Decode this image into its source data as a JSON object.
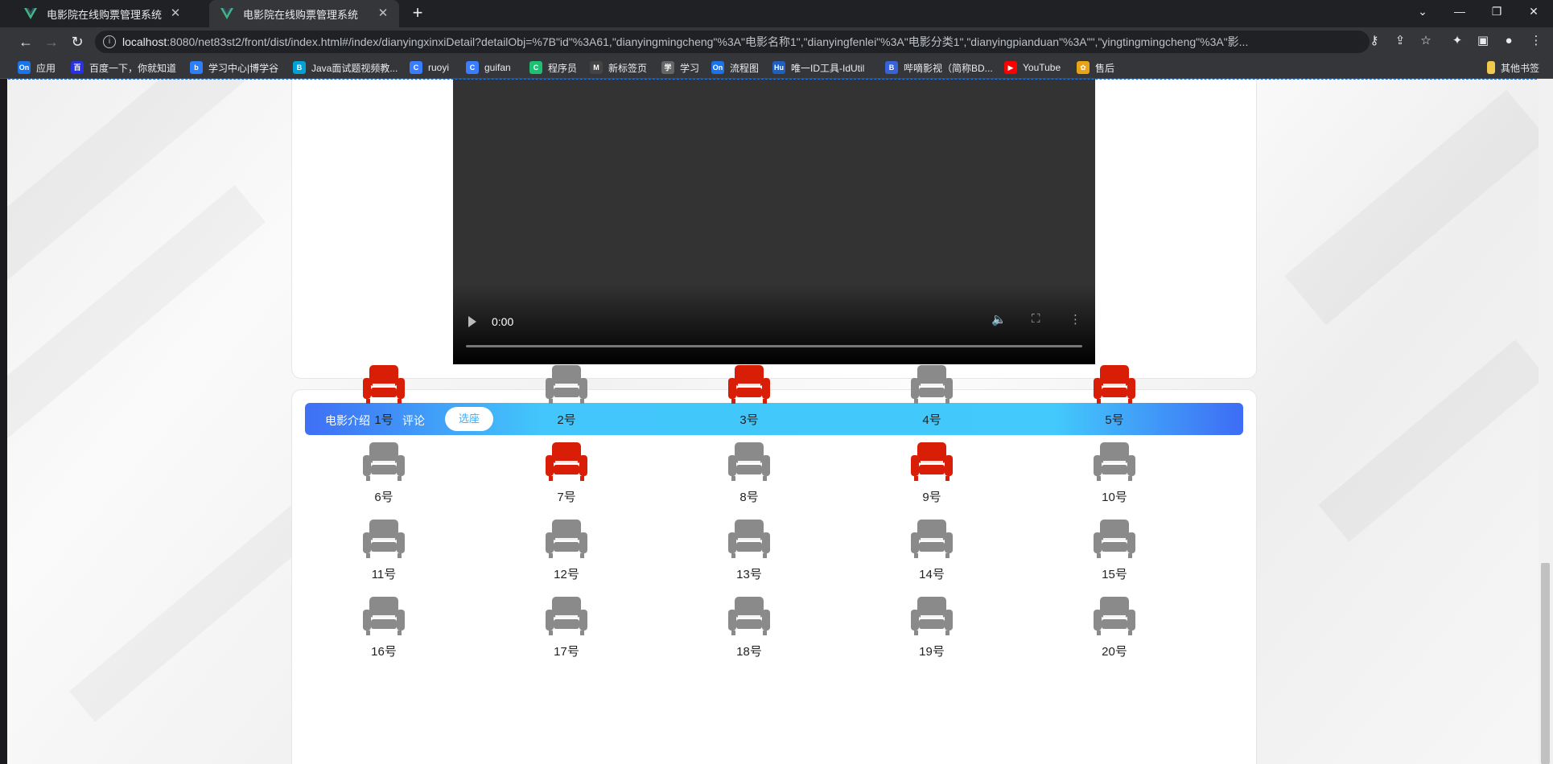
{
  "browser": {
    "tabs": [
      {
        "title": "电影院在线购票管理系统"
      },
      {
        "title": "电影院在线购票管理系统"
      }
    ],
    "url_host": "localhost",
    "url_rest": ":8080/net83st2/front/dist/index.html#/index/dianyingxinxiDetail?detailObj=%7B\"id\"%3A61,\"dianyingmingcheng\"%3A\"电影名称1\",\"dianyingfenlei\"%3A\"电影分类1\",\"dianyingpianduan\"%3A\"\",\"yingtingmingcheng\"%3A\"影...",
    "bookmarks": [
      {
        "label": "应用",
        "icon": "apps-icon",
        "color": "#1a73e8",
        "glyph": "On"
      },
      {
        "label": "百度一下，你就知道",
        "icon": "baidu-icon",
        "color": "#2932e1",
        "glyph": "百"
      },
      {
        "label": "学习中心|博学谷",
        "icon": "boxuegu-icon",
        "color": "#2d7ff9",
        "glyph": "b"
      },
      {
        "label": "Java面试题视频教...",
        "icon": "bilibili-icon",
        "color": "#00a1d6",
        "glyph": "B"
      },
      {
        "label": "ruoyi",
        "icon": "csdn-icon",
        "color": "#3a7cff",
        "glyph": "C"
      },
      {
        "label": "guifan",
        "icon": "csdn-icon",
        "color": "#3a7cff",
        "glyph": "C"
      },
      {
        "label": "程序员",
        "icon": "c-icon",
        "color": "#1dbf73",
        "glyph": "C"
      },
      {
        "label": "新标签页",
        "icon": "m-icon",
        "color": "#444444",
        "glyph": "M"
      },
      {
        "label": "学习",
        "icon": "notion-icon",
        "color": "#666666",
        "glyph": "学"
      },
      {
        "label": "流程图",
        "icon": "processon-icon",
        "color": "#1a73e8",
        "glyph": "On"
      },
      {
        "label": "唯一ID工具-IdUtil",
        "icon": "hutool-icon",
        "color": "#1e5fbf",
        "glyph": "Hu"
      },
      {
        "label": "哔嘀影视（简称BD...",
        "icon": "bd-icon",
        "color": "#3a62d8",
        "glyph": "B"
      },
      {
        "label": "YouTube",
        "icon": "youtube-icon",
        "color": "#ff0000",
        "glyph": "▶"
      },
      {
        "label": "售后",
        "icon": "shouhou-icon",
        "color": "#e8a317",
        "glyph": "✿"
      }
    ],
    "other_bookmarks": "其他书签"
  },
  "video": {
    "time": "0:00"
  },
  "detail_tabs": {
    "intro": "电影介绍",
    "comment": "评论",
    "seat": "选座"
  },
  "seats": [
    {
      "label": "1号",
      "taken": true
    },
    {
      "label": "2号",
      "taken": false
    },
    {
      "label": "3号",
      "taken": true
    },
    {
      "label": "4号",
      "taken": false
    },
    {
      "label": "5号",
      "taken": true
    },
    {
      "label": "6号",
      "taken": false
    },
    {
      "label": "7号",
      "taken": true
    },
    {
      "label": "8号",
      "taken": false
    },
    {
      "label": "9号",
      "taken": true
    },
    {
      "label": "10号",
      "taken": false
    },
    {
      "label": "11号",
      "taken": false
    },
    {
      "label": "12号",
      "taken": false
    },
    {
      "label": "13号",
      "taken": false
    },
    {
      "label": "14号",
      "taken": false
    },
    {
      "label": "15号",
      "taken": false
    },
    {
      "label": "16号",
      "taken": false
    },
    {
      "label": "17号",
      "taken": false
    },
    {
      "label": "18号",
      "taken": false
    },
    {
      "label": "19号",
      "taken": false
    },
    {
      "label": "20号",
      "taken": false
    }
  ],
  "colors": {
    "seat_taken": "#d81e06",
    "seat_free": "#8a8a8a",
    "tab_gradient_start": "#3f6ff5",
    "tab_gradient_mid": "#42c6fb"
  }
}
